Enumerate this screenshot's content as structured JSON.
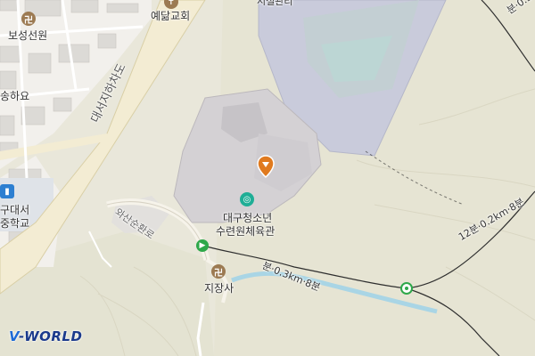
{
  "map": {
    "places": {
      "church": "예닮교회",
      "temple_boseong": "보성선원",
      "songhayo": "송하요",
      "school_line1": "구대서",
      "school_line2": "중학교",
      "youth_center_line1": "대구청소년",
      "youth_center_line2": "수련원체육관",
      "jijangsa": "지장사",
      "top_cut_label": "시설관리",
      "top_right_cut": "분·0.3k"
    },
    "roads": {
      "daeseo_underpass": "대서지하차도",
      "wasan_loop": "와산순환로"
    },
    "trails": {
      "trail_1": "분·0.3km·8분",
      "trail_2": "12분·0.2km·8분"
    },
    "icons": {
      "temple": "manji-icon",
      "church": "church-icon",
      "school": "school-icon",
      "sports": "sports-center-icon",
      "pin": "location-pin-icon",
      "trail_start": "trail-start-icon",
      "trail_marker": "trail-marker-icon"
    },
    "colors": {
      "background": "#e9e7da",
      "urban": "#f2f0ec",
      "building": "#d4d1d4",
      "road": "#f3ecd3",
      "facility": "#c9cbdb",
      "water": "#a9d5e5",
      "trail": "#2e2e2e",
      "poi_brown": "#9c7a52",
      "poi_teal": "#1fae96",
      "poi_blue": "#2d7fd1",
      "pin_orange": "#e07a1f",
      "trail_green": "#2ea84a"
    }
  },
  "branding": {
    "logo_prefix": "V",
    "logo_suffix": "-WORLD"
  }
}
